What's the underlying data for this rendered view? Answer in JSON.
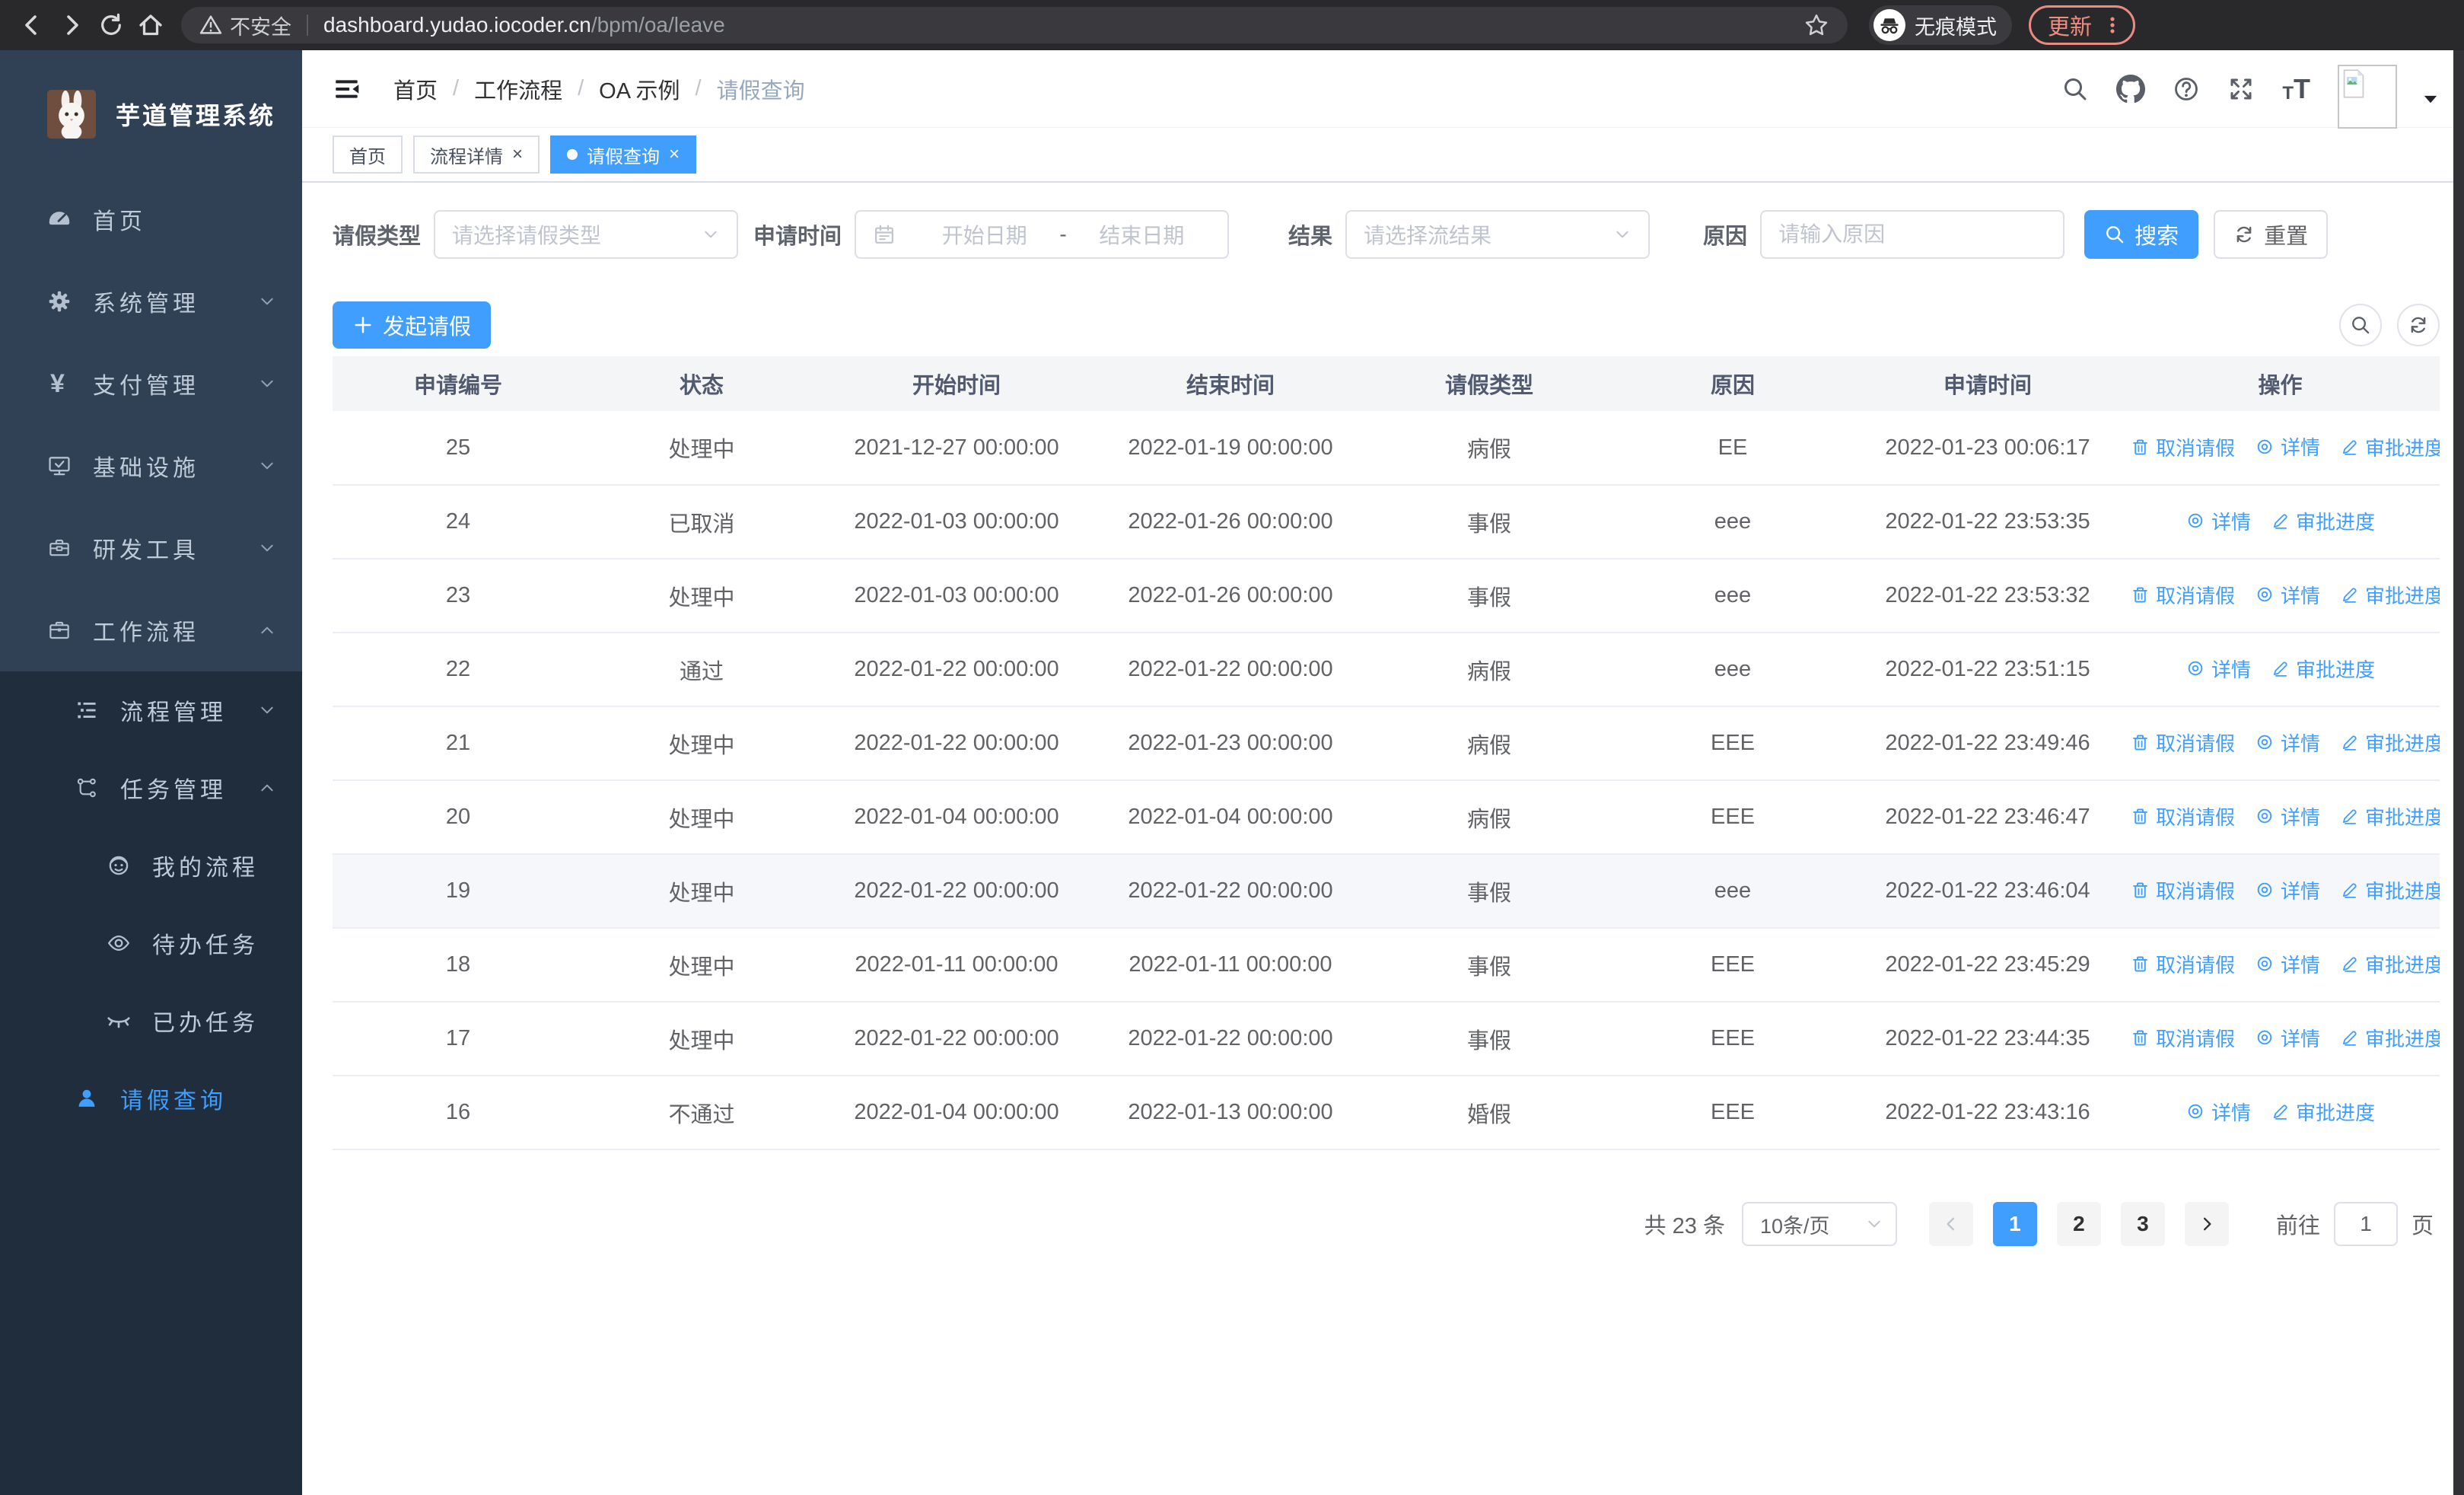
{
  "colors": {
    "accent": "#409eff",
    "sidebar_bg": "#304156",
    "submenu_bg": "#1f2d3d",
    "chrome_bg": "#29292c",
    "update_accent": "#ef8d80"
  },
  "browser": {
    "security_label": "不安全",
    "url_host": "dashboard.yudao.iocoder.cn",
    "url_path": "/bpm/oa/leave",
    "incognito_label": "无痕模式",
    "update_label": "更新"
  },
  "sidebar": {
    "app_title": "芋道管理系统",
    "items": [
      {
        "name": "home",
        "label": "首页",
        "icon": "gauge",
        "level": 1,
        "chevron": null,
        "active": false
      },
      {
        "name": "system",
        "label": "系统管理",
        "icon": "gear",
        "level": 1,
        "chevron": "down",
        "active": false
      },
      {
        "name": "payment",
        "label": "支付管理",
        "icon": "yen",
        "level": 1,
        "chevron": "down",
        "active": false
      },
      {
        "name": "infra",
        "label": "基础设施",
        "icon": "monitor",
        "level": 1,
        "chevron": "down",
        "active": false
      },
      {
        "name": "devtools",
        "label": "研发工具",
        "icon": "toolbox",
        "level": 1,
        "chevron": "down",
        "active": false
      },
      {
        "name": "workflow",
        "label": "工作流程",
        "icon": "suitcase",
        "level": 1,
        "chevron": "up",
        "active": false
      },
      {
        "name": "process-mgmt",
        "label": "流程管理",
        "icon": "tree-list",
        "level": 2,
        "chevron": "down",
        "active": false
      },
      {
        "name": "task-mgmt",
        "label": "任务管理",
        "icon": "share",
        "level": 2,
        "chevron": "up",
        "active": false
      },
      {
        "name": "my-process",
        "label": "我的流程",
        "icon": "face",
        "level": 3,
        "chevron": null,
        "active": false
      },
      {
        "name": "todo-tasks",
        "label": "待办任务",
        "icon": "eye",
        "level": 3,
        "chevron": null,
        "active": false
      },
      {
        "name": "done-tasks",
        "label": "已办任务",
        "icon": "eye-closed",
        "level": 3,
        "chevron": null,
        "active": false
      },
      {
        "name": "leave-query",
        "label": "请假查询",
        "icon": "user",
        "level": 2,
        "chevron": null,
        "active": true
      }
    ]
  },
  "breadcrumb": [
    "首页",
    "工作流程",
    "OA 示例",
    "请假查询"
  ],
  "tabs": [
    {
      "label": "首页",
      "active": false,
      "closable": false
    },
    {
      "label": "流程详情",
      "active": false,
      "closable": true
    },
    {
      "label": "请假查询",
      "active": true,
      "closable": true
    }
  ],
  "filters": {
    "leave_type_label": "请假类型",
    "leave_type_placeholder": "请选择请假类型",
    "apply_time_label": "申请时间",
    "start_date_placeholder": "开始日期",
    "range_separator": "-",
    "end_date_placeholder": "结束日期",
    "result_label": "结果",
    "result_placeholder": "请选择流结果",
    "reason_label": "原因",
    "reason_placeholder": "请输入原因",
    "search_label": "搜索",
    "reset_label": "重置"
  },
  "toolbar": {
    "create_label": "发起请假"
  },
  "table": {
    "columns": [
      "申请编号",
      "状态",
      "开始时间",
      "结束时间",
      "请假类型",
      "原因",
      "申请时间",
      "操作"
    ],
    "action_labels": {
      "cancel": "取消请假",
      "detail": "详情",
      "progress": "审批进度"
    },
    "rows": [
      {
        "id": "25",
        "status": "处理中",
        "start": "2021-12-27 00:00:00",
        "end": "2022-01-19 00:00:00",
        "type": "病假",
        "reason": "EE",
        "apply": "2022-01-23 00:06:17",
        "actions": [
          "cancel",
          "detail",
          "progress"
        ],
        "highlighted": false
      },
      {
        "id": "24",
        "status": "已取消",
        "start": "2022-01-03 00:00:00",
        "end": "2022-01-26 00:00:00",
        "type": "事假",
        "reason": "eee",
        "apply": "2022-01-22 23:53:35",
        "actions": [
          "detail",
          "progress"
        ],
        "highlighted": false
      },
      {
        "id": "23",
        "status": "处理中",
        "start": "2022-01-03 00:00:00",
        "end": "2022-01-26 00:00:00",
        "type": "事假",
        "reason": "eee",
        "apply": "2022-01-22 23:53:32",
        "actions": [
          "cancel",
          "detail",
          "progress"
        ],
        "highlighted": false
      },
      {
        "id": "22",
        "status": "通过",
        "start": "2022-01-22 00:00:00",
        "end": "2022-01-22 00:00:00",
        "type": "病假",
        "reason": "eee",
        "apply": "2022-01-22 23:51:15",
        "actions": [
          "detail",
          "progress"
        ],
        "highlighted": false
      },
      {
        "id": "21",
        "status": "处理中",
        "start": "2022-01-22 00:00:00",
        "end": "2022-01-23 00:00:00",
        "type": "病假",
        "reason": "EEE",
        "apply": "2022-01-22 23:49:46",
        "actions": [
          "cancel",
          "detail",
          "progress"
        ],
        "highlighted": false
      },
      {
        "id": "20",
        "status": "处理中",
        "start": "2022-01-04 00:00:00",
        "end": "2022-01-04 00:00:00",
        "type": "病假",
        "reason": "EEE",
        "apply": "2022-01-22 23:46:47",
        "actions": [
          "cancel",
          "detail",
          "progress"
        ],
        "highlighted": false
      },
      {
        "id": "19",
        "status": "处理中",
        "start": "2022-01-22 00:00:00",
        "end": "2022-01-22 00:00:00",
        "type": "事假",
        "reason": "eee",
        "apply": "2022-01-22 23:46:04",
        "actions": [
          "cancel",
          "detail",
          "progress"
        ],
        "highlighted": true
      },
      {
        "id": "18",
        "status": "处理中",
        "start": "2022-01-11 00:00:00",
        "end": "2022-01-11 00:00:00",
        "type": "事假",
        "reason": "EEE",
        "apply": "2022-01-22 23:45:29",
        "actions": [
          "cancel",
          "detail",
          "progress"
        ],
        "highlighted": false
      },
      {
        "id": "17",
        "status": "处理中",
        "start": "2022-01-22 00:00:00",
        "end": "2022-01-22 00:00:00",
        "type": "事假",
        "reason": "EEE",
        "apply": "2022-01-22 23:44:35",
        "actions": [
          "cancel",
          "detail",
          "progress"
        ],
        "highlighted": false
      },
      {
        "id": "16",
        "status": "不通过",
        "start": "2022-01-04 00:00:00",
        "end": "2022-01-13 00:00:00",
        "type": "婚假",
        "reason": "EEE",
        "apply": "2022-01-22 23:43:16",
        "actions": [
          "detail",
          "progress"
        ],
        "highlighted": false
      }
    ]
  },
  "pagination": {
    "total_label": "共 23 条",
    "page_size_label": "10条/页",
    "pages": [
      "1",
      "2",
      "3"
    ],
    "active_page": "1",
    "goto_label": "前往",
    "goto_value": "1",
    "goto_suffix": "页"
  }
}
